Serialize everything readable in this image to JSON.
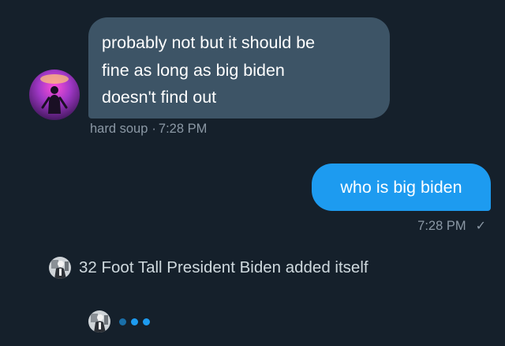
{
  "conversation": {
    "incoming_message": {
      "lines": [
        "probably not but it should be",
        "fine as long as big biden",
        "doesn't find out"
      ],
      "sender": "hard soup",
      "separator": "·",
      "time": "7:28 PM"
    },
    "outgoing_message": {
      "text": "who is big biden",
      "time": "7:28 PM",
      "status_icon": "single-check"
    },
    "system_event": {
      "icon": "biden-avatar",
      "text": "32 Foot Tall President Biden added itself"
    },
    "typing_indicator": {
      "avatar": "biden-avatar",
      "dot_colors": [
        "#1a6fa8",
        "#1d9bf0",
        "#1d9bf0"
      ]
    }
  },
  "colors": {
    "background": "#15202b",
    "incoming_bubble": "#3d5466",
    "outgoing_bubble": "#1d9bf0",
    "meta_text": "#8b98a5",
    "system_text": "#cfd9de"
  }
}
